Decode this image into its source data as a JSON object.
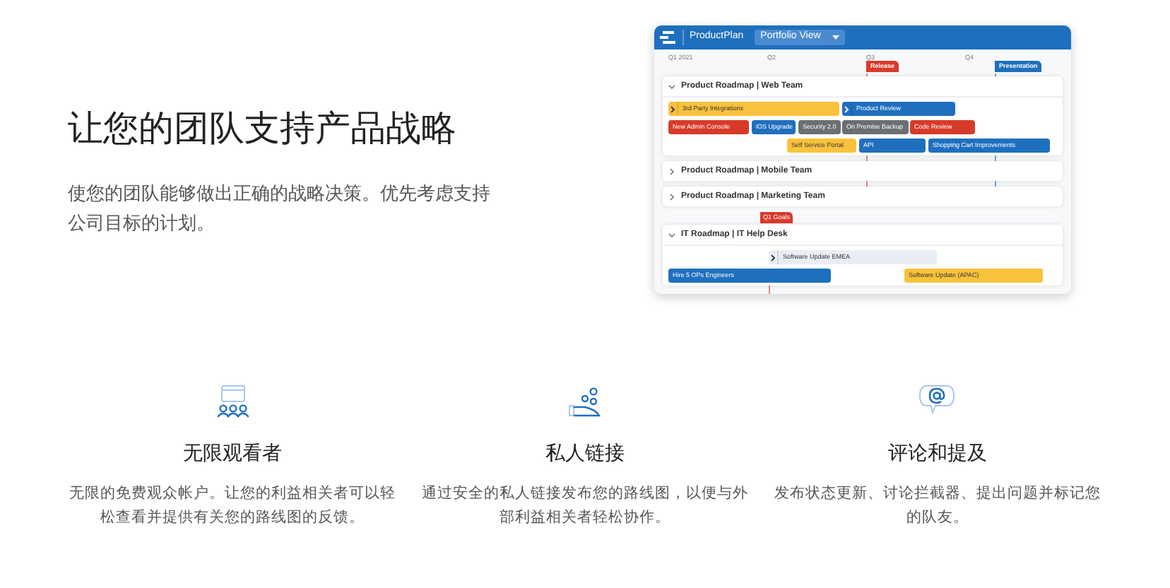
{
  "hero": {
    "title": "让您的团队支持产品战略",
    "description": "使您的团队能够做出正确的战略决策。优先考虑支持公司目标的计划。"
  },
  "app": {
    "brand": "ProductPlan",
    "view": "Portfolio View",
    "quarters": [
      "Q1 2021",
      "Q2",
      "Q3",
      "Q4"
    ],
    "milestones": [
      {
        "label": "Release",
        "color": "#d83a2a"
      },
      {
        "label": "Presentation",
        "color": "#1f6fbf"
      }
    ],
    "roadmaps": [
      {
        "title": "Product Roadmap | Web Team",
        "expanded": true,
        "bars": [
          {
            "label": "3rd Party Integrations",
            "color": "#f9c23c",
            "chevron": true
          },
          {
            "label": "Product Review",
            "color": "#1f6fbf",
            "chevron": true
          },
          {
            "label": "New Admin Console",
            "color": "#d83a2a",
            "chevron": false
          },
          {
            "label": "iOS Upgrade",
            "color": "#1f6fbf",
            "chevron": false
          },
          {
            "label": "Security 2.0",
            "color": "#6b6f73",
            "chevron": false
          },
          {
            "label": "On Premise Backup",
            "color": "#6b6f73",
            "chevron": false
          },
          {
            "label": "Code Review",
            "color": "#d83a2a",
            "chevron": false
          },
          {
            "label": "Self Service Portal",
            "color": "#f9c23c",
            "chevron": false
          },
          {
            "label": "API",
            "color": "#1f6fbf",
            "chevron": false
          },
          {
            "label": "Shopping Cart Improvements",
            "color": "#1f6fbf",
            "chevron": false
          }
        ]
      },
      {
        "title": "Product Roadmap | Mobile Team",
        "expanded": false
      },
      {
        "title": "Product Roadmap | Marketing Team",
        "expanded": false
      },
      {
        "title": "IT Roadmap | IT Help Desk",
        "expanded": true,
        "flag": {
          "label": "Q1 Goals",
          "color": "#d83a2a"
        },
        "bars": [
          {
            "label": "Software Update EMEA",
            "color": "#e9eef5",
            "chevron": true
          },
          {
            "label": "Hire 5 OPs Engineers",
            "color": "#1f6fbf",
            "chevron": false
          },
          {
            "label": "Software Update (APAC)",
            "color": "#f9c23c",
            "chevron": false
          }
        ]
      }
    ]
  },
  "features": [
    {
      "kind": "viewers",
      "title": "无限观看者",
      "description": "无限的免费观众帐户。让您的利益相关者可以轻松查看并提供有关您的路线图的反馈。"
    },
    {
      "kind": "link",
      "title": "私人链接",
      "description": "通过安全的私人链接发布您的路线图，以便与外部利益相关者轻松协作。"
    },
    {
      "kind": "mention",
      "title": "评论和提及",
      "description": "发布状态更新、讨论拦截器、提出问题并标记您的队友。"
    }
  ]
}
